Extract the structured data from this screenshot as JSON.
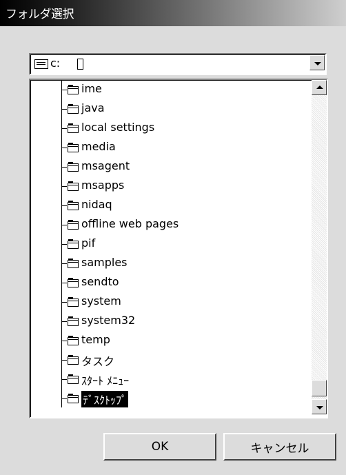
{
  "window": {
    "title": "フォルダ選択"
  },
  "drive_combo": {
    "value": "c:",
    "icon": "drive-icon"
  },
  "folder_tree": {
    "icon": "folder-icon",
    "items": [
      {
        "label": "ime"
      },
      {
        "label": "java"
      },
      {
        "label": "local settings"
      },
      {
        "label": "media"
      },
      {
        "label": "msagent"
      },
      {
        "label": "msapps"
      },
      {
        "label": "nidaq"
      },
      {
        "label": "offline web pages"
      },
      {
        "label": "pif"
      },
      {
        "label": "samples"
      },
      {
        "label": "sendto"
      },
      {
        "label": "system"
      },
      {
        "label": "system32"
      },
      {
        "label": "temp"
      },
      {
        "label": "タスク"
      },
      {
        "label": "ｽﾀｰﾄ ﾒﾆｭｰ"
      },
      {
        "label": "ﾃﾞｽｸﾄｯﾌﾟ",
        "selected": true
      }
    ]
  },
  "buttons": {
    "ok": "OK",
    "cancel": "キャンセル"
  },
  "colors": {
    "selection": "#000000",
    "dialog_bg": "#dcdcdc"
  }
}
